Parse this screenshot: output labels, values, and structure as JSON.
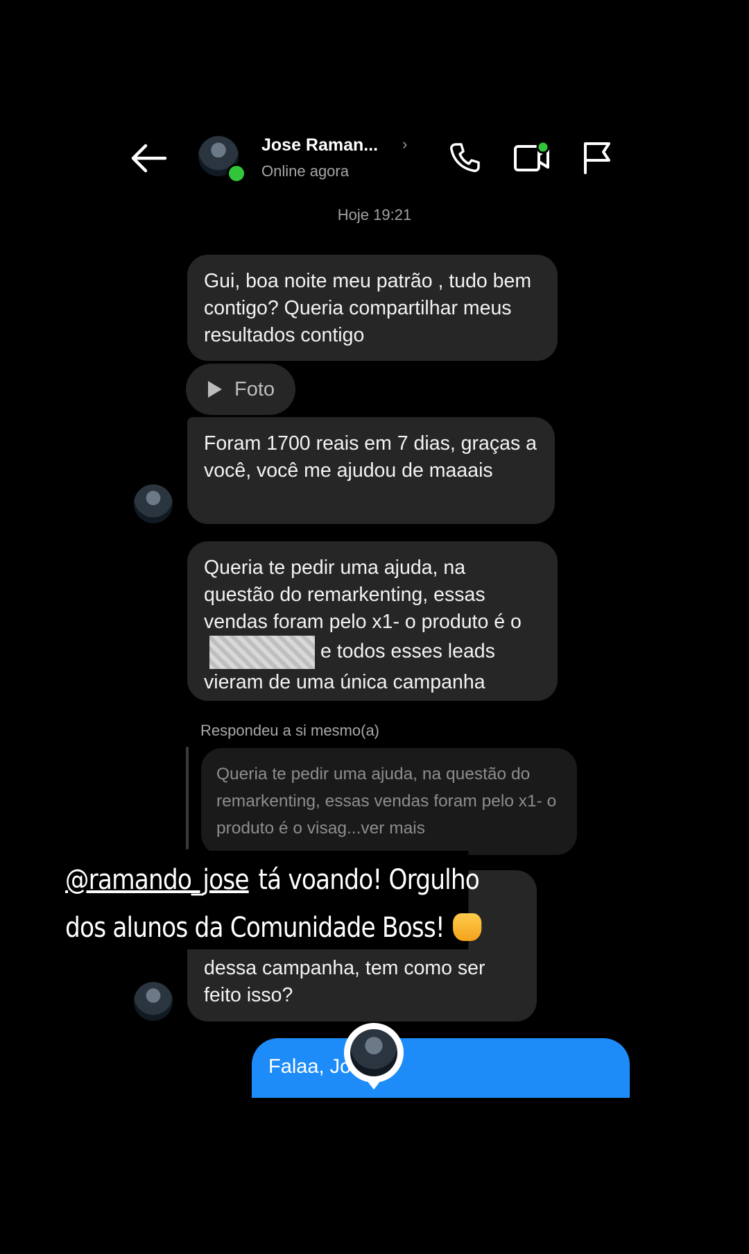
{
  "header": {
    "contact_name": "Jose Raman...",
    "chevron": "›",
    "status": "Online agora",
    "icons": [
      "back-arrow-icon",
      "phone-icon",
      "video-call-icon",
      "flag-icon"
    ],
    "online_color": "#31c63a"
  },
  "timestamp": "Hoje 19:21",
  "messages": {
    "m1": "Gui, boa noite meu patrão , tudo bem contigo? Queria compartilhar meus resultados contigo",
    "photo_label": "Foto",
    "m2": "Foram 1700 reais em 7 dias, graças a você, você me ajudou de maaais",
    "m3_before": "Queria te pedir uma ajuda, na questão do remarkenting, essas vendas foram pelo x1- o produto é o",
    "m3_after": "e todos esses leads vieram de uma única campanha",
    "reply_label": "Respondeu a si mesmo(a)",
    "reply_quote": "Queria te pedir uma ajuda, na questão do remarkenting, essas vendas foram pelo x1- o produto é o visag...ver mais",
    "m4": "dessa campanha, tem como ser feito isso?",
    "outgoing": "Falaa, Jo"
  },
  "story": {
    "mention": "@ramando_jose",
    "line1_rest": "tá voando! Orgulho",
    "line2": "dos alunos da Comunidade Boss!",
    "emoji_icon": "fist-emoji-icon"
  },
  "colors": {
    "background": "#000000",
    "incoming_bubble": "#262626",
    "outgoing_bubble": "#1d8cf8"
  }
}
